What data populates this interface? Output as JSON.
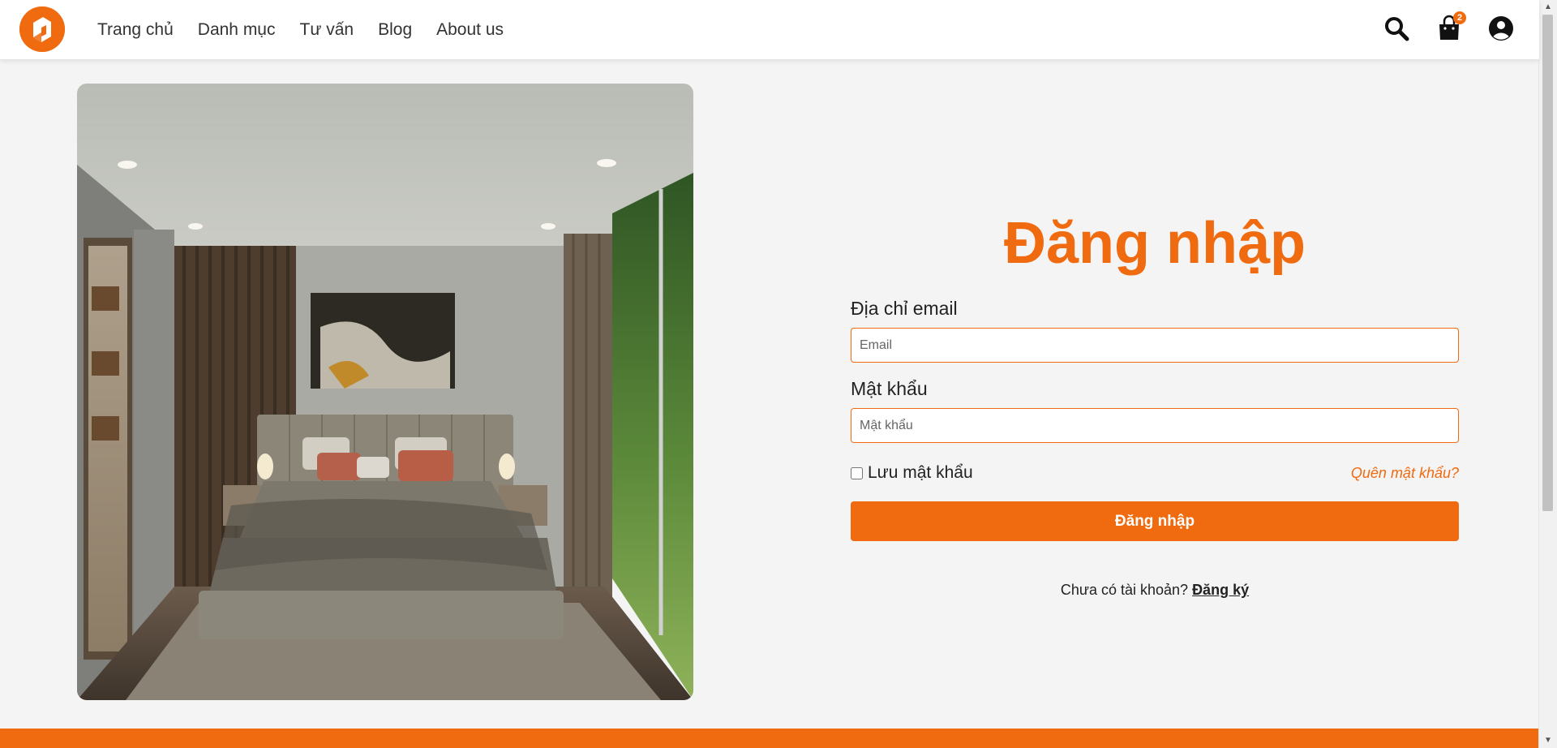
{
  "brand": {
    "accent_color": "#f06a0f"
  },
  "nav": {
    "items": [
      {
        "label": "Trang chủ"
      },
      {
        "label": "Danh mục"
      },
      {
        "label": "Tư vấn"
      },
      {
        "label": "Blog"
      },
      {
        "label": "About us"
      }
    ]
  },
  "header_icons": {
    "search": "search-icon",
    "cart": "shopping-bag-icon",
    "cart_count": "2",
    "account": "user-circle-icon"
  },
  "login": {
    "title": "Đăng nhập",
    "email_label": "Địa chỉ email",
    "email_placeholder": "Email",
    "email_value": "",
    "password_label": "Mật khẩu",
    "password_placeholder": "Mật khẩu",
    "password_value": "",
    "remember_label": "Lưu mật khẩu",
    "remember_checked": false,
    "forgot_label": "Quên mật khẩu?",
    "submit_label": "Đăng nhập",
    "signup_prompt": "Chưa có tài khoản?",
    "signup_link": "Đăng ký"
  }
}
